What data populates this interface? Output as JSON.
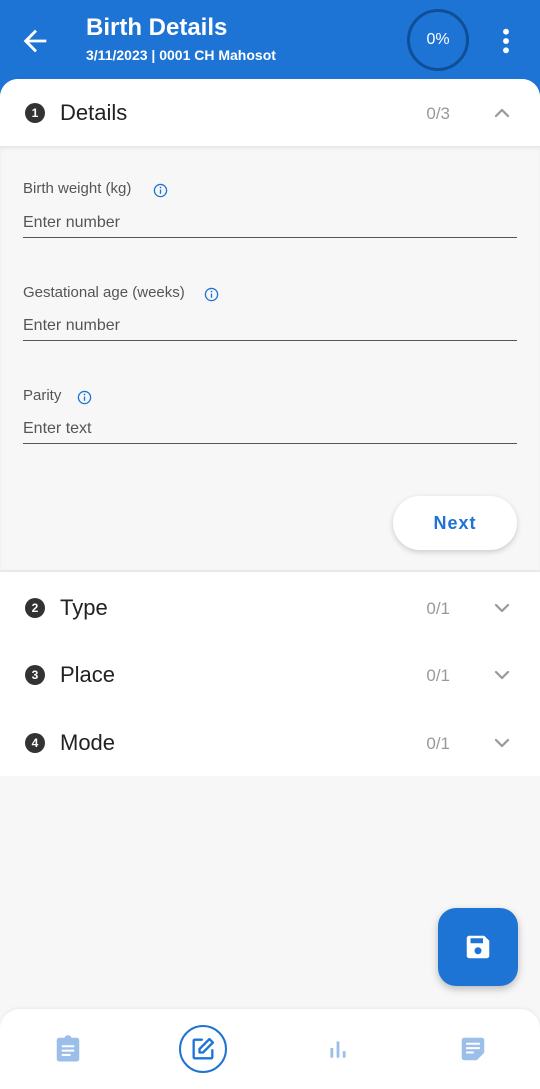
{
  "header": {
    "title": "Birth Details",
    "subtitle": "3/11/2023 | 0001 CH Mahosot",
    "progress": "0%"
  },
  "sections": [
    {
      "number": "1",
      "title": "Details",
      "count": "0/3",
      "expanded": true
    },
    {
      "number": "2",
      "title": "Type",
      "count": "0/1",
      "expanded": false
    },
    {
      "number": "3",
      "title": "Place",
      "count": "0/1",
      "expanded": false
    },
    {
      "number": "4",
      "title": "Mode",
      "count": "0/1",
      "expanded": false
    }
  ],
  "form": {
    "fields": [
      {
        "label": "Birth weight (kg)",
        "placeholder": "Enter number"
      },
      {
        "label": "Gestational age (weeks)",
        "placeholder": "Enter number"
      },
      {
        "label": "Parity",
        "placeholder": "Enter text"
      }
    ],
    "next_label": "Next"
  },
  "colors": {
    "primary": "#1e74d4",
    "nav_icon": "#9bbfe8"
  },
  "icons": {
    "back": "arrow-left-icon",
    "more": "more-vert-icon",
    "info": "info-icon",
    "save": "save-icon",
    "nav": [
      "clipboard-icon",
      "edit-icon",
      "bar-chart-icon",
      "notes-icon"
    ]
  }
}
